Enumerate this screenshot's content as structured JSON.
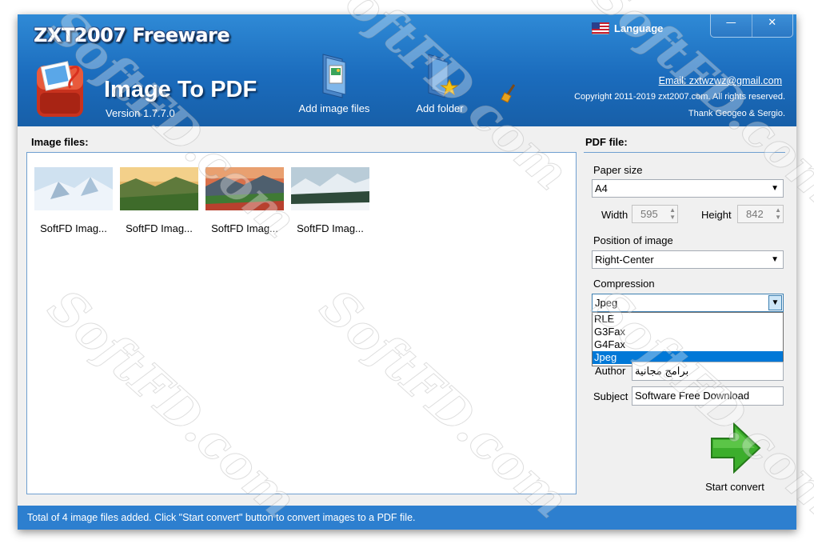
{
  "window": {
    "brand": "ZXT2007 Freeware",
    "app_title": "Image To PDF",
    "version": "Version 1.7.7.0",
    "minimize_glyph": "—",
    "close_glyph": "✕"
  },
  "toolbar": {
    "add_image_files": "Add image files",
    "add_folder": "Add folder",
    "clean_icon": "broom-icon"
  },
  "header_right": {
    "language": "Language",
    "email": "Email: zxtwzwz@gmail.com",
    "copyright": "Copyright  2011-2019 zxt2007.com.  All rights reserved.",
    "thanks": "Thank Geogeo & Sergio."
  },
  "image_files": {
    "label": "Image files:",
    "items": [
      {
        "caption": "SoftFD Imag..."
      },
      {
        "caption": "SoftFD Imag..."
      },
      {
        "caption": "SoftFD Imag..."
      },
      {
        "caption": "SoftFD Imag..."
      }
    ]
  },
  "pdf": {
    "label": "PDF file:",
    "paper_size_label": "Paper size",
    "paper_size_value": "A4",
    "width_label": "Width",
    "width_value": "595",
    "height_label": "Height",
    "height_value": "842",
    "position_label": "Position of image",
    "position_value": "Right-Center",
    "compression_label": "Compression",
    "compression_value": "Jpeg",
    "compression_options": [
      "RLE",
      "G3Fax",
      "G4Fax",
      "Jpeg"
    ],
    "author_label": "Author",
    "author_value": "برامج مجانية",
    "subject_label": "Subject",
    "subject_value": "Software Free Download",
    "start_convert": "Start convert"
  },
  "status": {
    "text": "Total of 4 image files added. Click \"Start convert\" button to convert images to a PDF file."
  },
  "watermark": "SoftFD.com",
  "colors": {
    "header": "#1b6cbd",
    "statusbar": "#2d7fcf",
    "panel_border": "#6f9fd0",
    "selection": "#0078d7",
    "arrow_green": "#3cae2c"
  }
}
